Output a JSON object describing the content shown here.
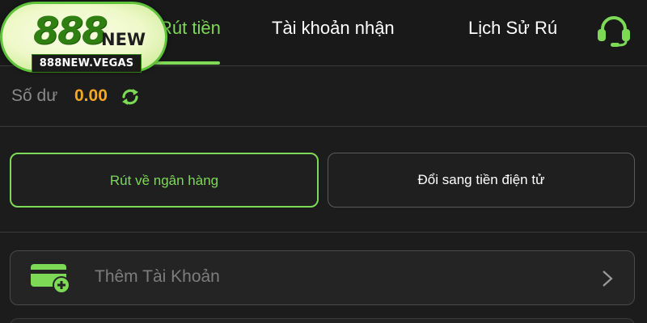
{
  "logo": {
    "number": "888",
    "suffix": "NEW",
    "domain": "888NEW.VEGAS"
  },
  "tabs": [
    {
      "label": "Rút tiền",
      "active": true
    },
    {
      "label": "Tài khoản nhận",
      "active": false
    },
    {
      "label": "Lịch Sử Rú",
      "active": false
    }
  ],
  "support": {
    "icon": "headset-icon"
  },
  "balance": {
    "label": "Số dư",
    "value": "0.00",
    "icon": "refresh-icon"
  },
  "options": {
    "bank": "Rút về ngân hàng",
    "crypto": "Đổi sang tiền điện tử"
  },
  "add_account": {
    "label": "Thêm Tài Khoản",
    "icon": "card-add-icon",
    "chevron": "chevron-right-icon"
  },
  "colors": {
    "accent": "#7ed957",
    "balance": "#f5a623",
    "background": "#1c1c1c"
  }
}
